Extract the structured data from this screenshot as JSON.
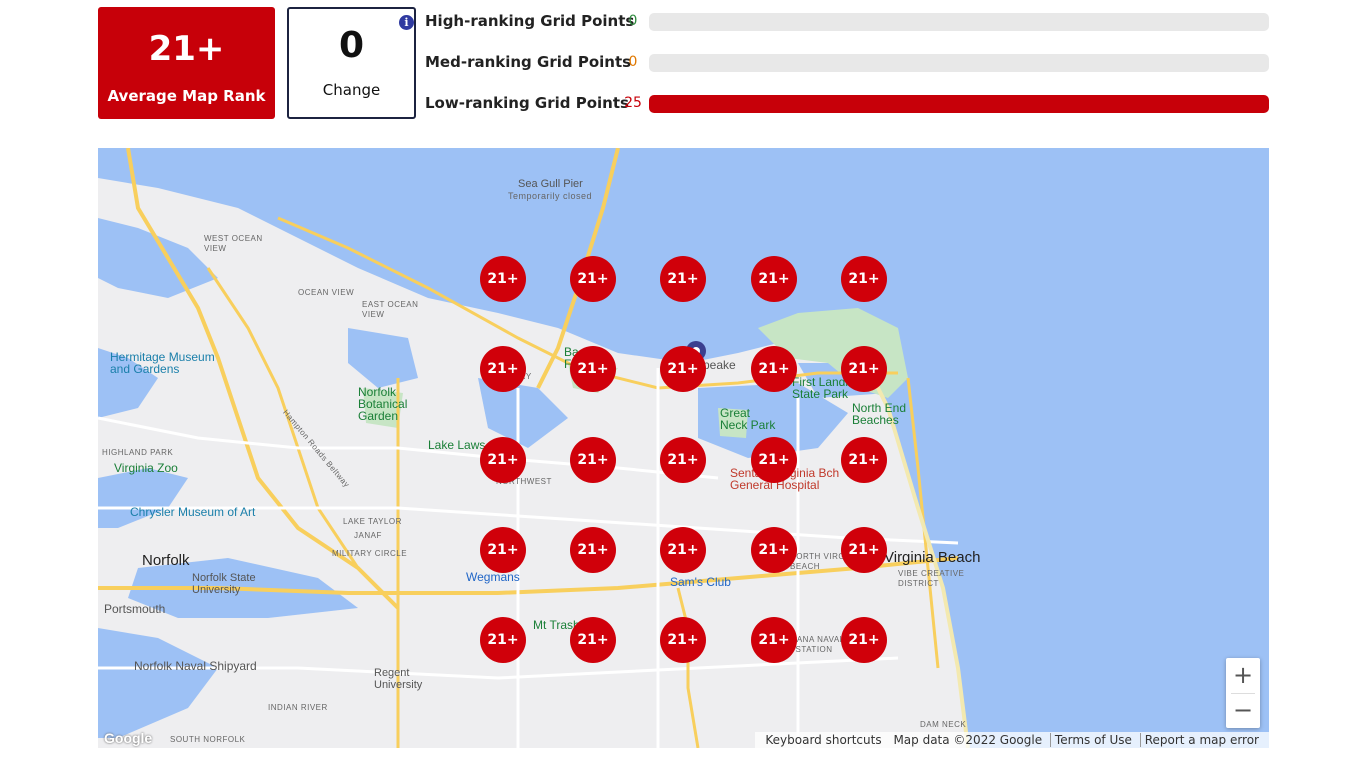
{
  "summary": {
    "average_rank_value": "21+",
    "average_rank_label": "Average Map Rank",
    "change_value": "0",
    "change_label": "Change",
    "info_icon": "i"
  },
  "stats": [
    {
      "label": "High-ranking Grid Points",
      "count": "0",
      "color": "#2e8b3e",
      "fill_fraction": 0
    },
    {
      "label": "Med-ranking Grid Points",
      "count": "0",
      "color": "#e07800",
      "fill_fraction": 0
    },
    {
      "label": "Low-ranking Grid Points",
      "count": "25",
      "color": "#c70009",
      "fill_fraction": 1
    }
  ],
  "map": {
    "grid_ranks": [
      [
        "21+",
        "21+",
        "21+",
        "21+",
        "21+"
      ],
      [
        "21+",
        "21+",
        "21+",
        "21+",
        "21+"
      ],
      [
        "21+",
        "21+",
        "21+",
        "21+",
        "21+"
      ],
      [
        "21+",
        "21+",
        "21+",
        "21+",
        "21+"
      ],
      [
        "21+",
        "21+",
        "21+",
        "21+",
        "21+"
      ]
    ],
    "place_labels": {
      "norfolk": "Norfolk",
      "virginia_beach": "Virginia Beach",
      "portsmouth": "Portsmouth",
      "sea_gull_pier": "Sea Gull Pier",
      "temporarily_closed": "Temporarily closed",
      "hermitage_museum": "Hermitage Museum\nand Gardens",
      "norfolk_botanical": "Norfolk\nBotanical\nGarden",
      "lake_lawson": "Lake Laws",
      "virginia_zoo": "Virginia Zoo",
      "chrysler_museum": "Chrysler Museum of Art",
      "norfolk_state": "Norfolk State\nUniversity",
      "wegmans": "Wegmans",
      "sams_club": "Sam's Club",
      "norfolk_naval": "Norfolk Naval Shipyard",
      "regent": "Regent\nUniversity",
      "first_landing": "First Landi\nState Park",
      "north_end_beaches": "North End\nBeaches",
      "great_neck_park": "Great\nNeck Park",
      "sentara": "Sentara Virginia Bch\nGeneral Hospital",
      "mt_trashmore": "Mt Trash",
      "west_ocean_view": "WEST OCEAN\nVIEW",
      "ocean_view": "OCEAN VIEW",
      "east_ocean_view": "EAST OCEAN\nVIEW",
      "highland_park": "HIGHLAND PARK",
      "lake_taylor": "LAKE TAYLOR",
      "janaf": "JANAF",
      "military_circle": "MILITARY CIRCLE",
      "northwest": "NORTHWEST",
      "north_va_beach": "NORTH VIRGINIA\nBEACH",
      "vibe_creative": "VIBE CREATIVE\nDISTRICT",
      "indian_river": "INDIAN RIVER",
      "south_norfolk": "SOUTH NORFOLK",
      "oceana": "OCEANA NAVAL\nAIR STATION",
      "dam_neck": "DAM NECK",
      "hampton_roads_beltway": "Hampton Roads Beltway",
      "history": "STORY",
      "chesapeake": "peake",
      "bay_farm": "Ba\nFarm"
    },
    "zoom_in": "+",
    "zoom_out": "−",
    "google_logo": "Google",
    "attribution": {
      "keyboard": "Keyboard shortcuts",
      "map_data": "Map data ©2022 Google",
      "terms": "Terms of Use",
      "report": "Report a map error"
    }
  },
  "colors": {
    "primary_red": "#c70009",
    "marker_red": "#d0000a",
    "water": "#9dc1f5",
    "land": "#eeeef0",
    "park": "#c7e5c5",
    "highway": "#f8cf5d"
  }
}
